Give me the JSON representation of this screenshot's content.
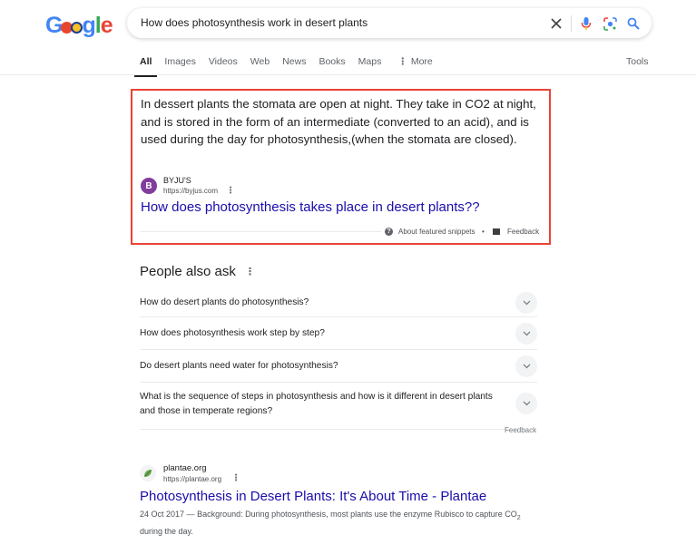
{
  "header": {
    "logo_letters": [
      "G",
      "o",
      "o",
      "g",
      "l",
      "e"
    ],
    "search_query": "How does photosynthesis work in desert plants",
    "icons": [
      "clear-icon",
      "microphone-icon",
      "lens-icon",
      "search-icon"
    ]
  },
  "tabs": {
    "items": [
      {
        "label": "All",
        "active": true
      },
      {
        "label": "Images",
        "active": false
      },
      {
        "label": "Videos",
        "active": false
      },
      {
        "label": "Web",
        "active": false
      },
      {
        "label": "News",
        "active": false
      },
      {
        "label": "Books",
        "active": false
      },
      {
        "label": "Maps",
        "active": false
      },
      {
        "label": "More",
        "active": false
      }
    ],
    "tools_label": "Tools"
  },
  "featured_snippet": {
    "answer": "In dessert plants the stomata are open at night. They take in CO2 at night, and is stored in the form of an intermediate (converted to an acid), and is used during the day for photosynthesis,(when the stomata are closed).",
    "source_name": "BYJU'S",
    "source_url": "https://byjus.com",
    "title": "How does photosynthesis takes place in desert plants??",
    "about_label": "About featured snippets",
    "separator": "•",
    "feedback_label": "Feedback",
    "highlight_color": "#ea4335"
  },
  "people_also_ask": {
    "title": "People also ask",
    "questions": [
      "How do desert plants do photosynthesis?",
      "How does photosynthesis work step by step?",
      "Do desert plants need water for photosynthesis?",
      "What is the sequence of steps in photosynthesis and how is it different in desert plants and those in temperate regions?"
    ],
    "feedback_label": "Feedback"
  },
  "results": [
    {
      "site_name": "plantae.org",
      "url": "https://plantae.org",
      "title": "Photosynthesis in Desert Plants: It's About Time - Plantae",
      "date": "24 Oct 2017",
      "dash": " — ",
      "snippet_pre": "Background: During photosynthesis, most plants use the enzyme Rubisco to capture CO",
      "snippet_sub": "2",
      "snippet_post": " during the day."
    }
  ],
  "colors": {
    "link": "#1a0dab",
    "text": "#202124",
    "secondary": "#4d5156"
  }
}
